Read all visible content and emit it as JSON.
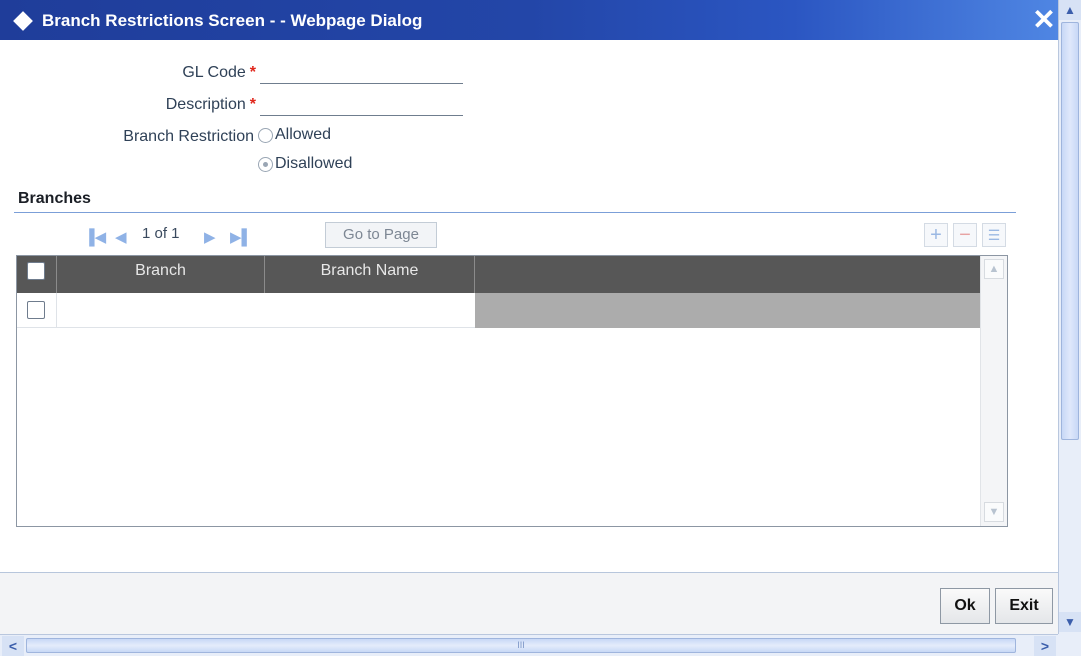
{
  "window": {
    "title": "Branch Restrictions Screen - - Webpage Dialog",
    "close_glyph": "✕"
  },
  "form": {
    "gl_code_label": "GL Code",
    "gl_code_value": "",
    "description_label": "Description",
    "description_value": "",
    "required_mark": "*",
    "branch_restriction_label": "Branch Restriction",
    "options": [
      {
        "label": "Allowed",
        "selected": false
      },
      {
        "label": "Disallowed",
        "selected": true
      }
    ]
  },
  "branches": {
    "section_title": "Branches",
    "pager": {
      "page_text": "1 of 1",
      "go_to_page_label": "Go to Page"
    },
    "toolbar_icons": [
      "add-row-icon",
      "delete-row-icon",
      "view-row-icon"
    ],
    "columns": [
      "Branch",
      "Branch Name"
    ],
    "rows": [
      {
        "branch": "",
        "branch_name": ""
      }
    ]
  },
  "footer": {
    "ok_label": "Ok",
    "exit_label": "Exit"
  },
  "scrollbar": {
    "h_thumb_grip": "III"
  },
  "colors": {
    "title_bar": "#2346a8",
    "grid_header": "#575757",
    "required": "#e0261b"
  }
}
